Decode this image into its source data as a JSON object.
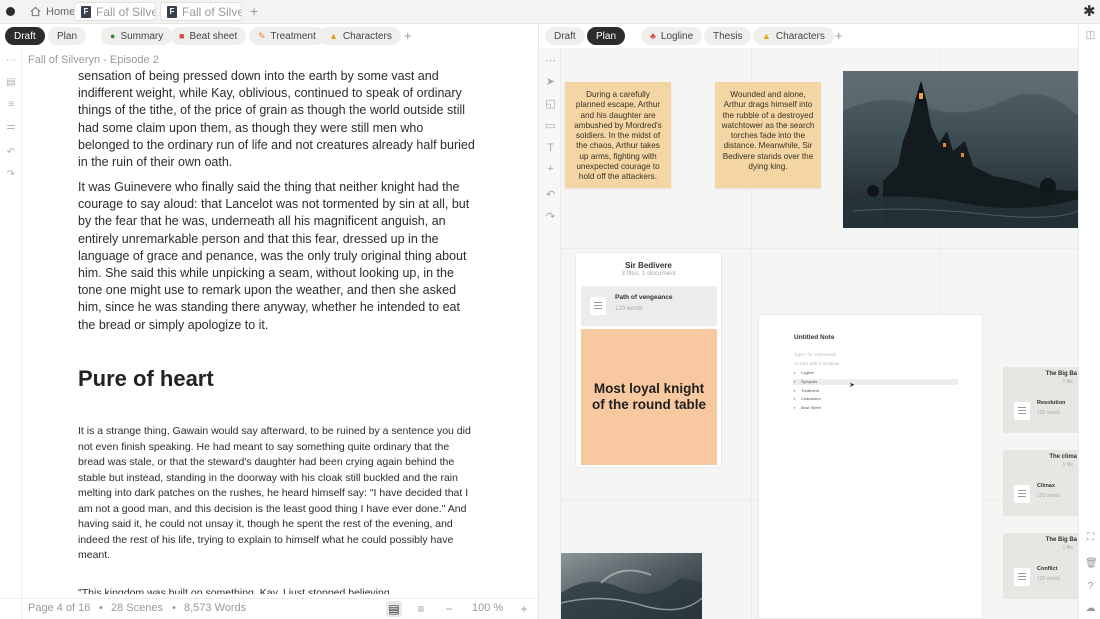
{
  "titlebar": {
    "home_label": "Home",
    "tabs": [
      {
        "label": "Fall of Silveryn",
        "icon_letter": "F"
      },
      {
        "label": "Fall of Silveryn",
        "icon_letter": "F"
      }
    ]
  },
  "left": {
    "tabs": [
      "Draft",
      "Plan",
      "Summary",
      "Beat sheet",
      "Treatment",
      "Characters"
    ],
    "breadcrumb": "Fall of Silveryn - Episode 2",
    "paragraph1": "sensation of being pressed down into the earth by some vast and indifferent weight, while Kay, oblivious, continued to speak of ordinary things of the tithe, of the price of grain as though the world outside still had some claim upon them, as though they were still men who belonged to the ordinary run of life and not creatures already half buried in the ruin of their own oath.",
    "paragraph2": "It was Guinevere who finally said the thing that neither knight had the courage to say aloud: that Lancelot was not tormented by sin at all, but by the fear that he was, underneath all his magnificent anguish, an entirely unremarkable person and that this fear, dressed up in the language of grace and penance, was the only truly original thing about him. She said this while unpicking a seam, without looking up, in the tone one might use to remark upon the weather, and then she asked him, since he was standing there anyway, whether he intended to eat the bread or simply apologize to it.",
    "heading": "Pure of heart",
    "paragraph3": "It is a strange thing, Gawain would say afterward, to be ruined by a sentence you did not even finish speaking. He had meant to say something quite ordinary that the bread was stale, or that the steward's daughter had been crying again behind the stable but instead, standing in the doorway with his cloak still buckled and the rain melting into dark patches on the rushes, he heard himself say: \"I have decided that I am not a good man, and this decision is the least good thing I have ever done.\" And having said it, he could not unsay it, though he spent the rest of the evening, and indeed the rest of his life, trying to explain to himself what he could possibly have meant.",
    "paragraph4": "\"This kingdom was built on something, Kay. I just stopped believing",
    "footer": {
      "page": "Page 4 of 16",
      "scenes": "28 Scenes",
      "words": "8,573 Words",
      "zoom": "100 %"
    }
  },
  "right": {
    "tabs": [
      "Draft",
      "Plan",
      "Logline",
      "Thesis",
      "Characters"
    ],
    "sticky1": "During a carefully planned escape, Arthur and his daughter are ambushed by Mordred's soldiers. In the midst of the chaos, Arthur takes up arms, fighting with unexpected courage to hold off the attackers.",
    "sticky2": "Wounded and alone, Arthur drags himself into the rubble of a destroyed watchtower as the search torches fade into the distance. Meanwhile, Sir Bedivere stands over the dying king.",
    "card": {
      "title": "Sir Bedivere",
      "subtitle": "3 files, 1 document",
      "doc_label": "Path of vengeance",
      "doc_words": "120 words",
      "quote": "Most loyal knight of the round table"
    },
    "note": {
      "title": "Untitled Note",
      "placeholder1": "Type / for commands",
      "placeholder2": "or start with a template",
      "items": [
        "Logline",
        "Synopsis",
        "Treatment",
        "Characters",
        "Beat Sheet"
      ]
    },
    "boards": [
      {
        "title": "The Big Ba",
        "sub": "1 file",
        "label": "Resolution",
        "words": "120 words"
      },
      {
        "title": "The clima",
        "sub": "1 file",
        "label": "Climax",
        "words": "120 words"
      },
      {
        "title": "The Big Ba",
        "sub": "1 file",
        "label": "Conflict",
        "words": "120 words"
      }
    ]
  }
}
